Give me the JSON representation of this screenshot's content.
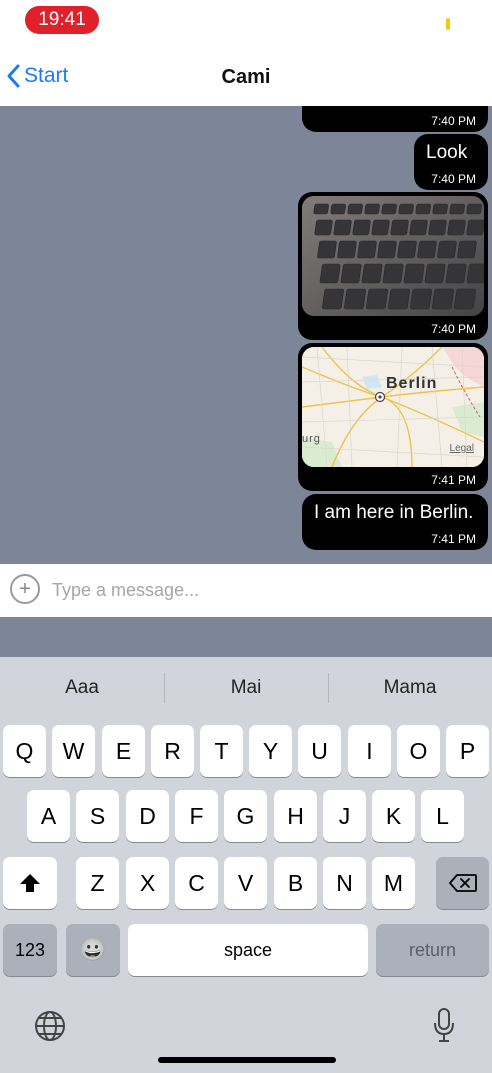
{
  "status": {
    "time": "19:41"
  },
  "nav": {
    "back_label": "Start",
    "title": "Cami"
  },
  "messages": [
    {
      "kind": "image",
      "time": "7:40 PM"
    },
    {
      "kind": "text",
      "text": "Look",
      "time": "7:40 PM"
    },
    {
      "kind": "image",
      "time": "7:40 PM"
    },
    {
      "kind": "map",
      "city": "Berlin",
      "partial_label": "urg",
      "legal": "Legal",
      "time": "7:41 PM"
    },
    {
      "kind": "text",
      "text": "I am here in Berlin.",
      "time": "7:41 PM"
    }
  ],
  "composer": {
    "placeholder": "Type a message..."
  },
  "keyboard": {
    "suggestions": [
      "Aaa",
      "Mai",
      "Mama"
    ],
    "row1": [
      "Q",
      "W",
      "E",
      "R",
      "T",
      "Y",
      "U",
      "I",
      "O",
      "P"
    ],
    "row2": [
      "A",
      "S",
      "D",
      "F",
      "G",
      "H",
      "J",
      "K",
      "L"
    ],
    "row3": [
      "Z",
      "X",
      "C",
      "V",
      "B",
      "N",
      "M"
    ],
    "numbers_label": "123",
    "emoji": "😀",
    "space_label": "space",
    "return_label": "return"
  },
  "colors": {
    "accent": "#1a7cf5",
    "chat_bg": "#7c8698",
    "bubble": "#000000",
    "time_pill": "#e0202a"
  }
}
